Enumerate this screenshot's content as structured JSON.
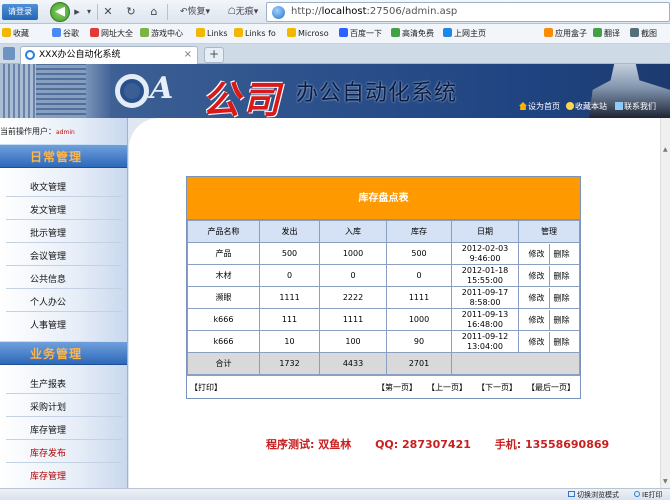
{
  "browser": {
    "login_label": "请登录",
    "back_glyph": "◀",
    "forward_glyph": "▸",
    "stop_glyph": "✕",
    "refresh_glyph": "↻",
    "home_glyph": "⌂",
    "restore_label": "恢复",
    "history_label": "无痕",
    "url_prefix": "http://",
    "url_host": "localhost",
    "url_rest": ":27506/admin.asp"
  },
  "bookmarks": [
    {
      "label": "收藏",
      "color": "#f2b800"
    },
    {
      "label": "谷歌",
      "color": "#4a8af4"
    },
    {
      "label": "网址大全",
      "color": "#e53935"
    },
    {
      "label": "游戏中心",
      "color": "#7cb342"
    },
    {
      "label": "Links",
      "color": "#f2b800"
    },
    {
      "label": "Links fo",
      "color": "#f2b800"
    },
    {
      "label": "Microso",
      "color": "#f2b800"
    },
    {
      "label": "百度一下",
      "color": "#2962ff"
    },
    {
      "label": "高清免费",
      "color": "#43a047"
    },
    {
      "label": "上网主页",
      "color": "#1e88e5"
    },
    {
      "label": "应用盒子",
      "color": "#fb8c00"
    },
    {
      "label": "翻译",
      "color": "#43a047"
    },
    {
      "label": "截图",
      "color": "#546e7a"
    }
  ],
  "tab": {
    "title": "XXX办公自动化系统",
    "close_glyph": "×",
    "new_tab_glyph": "+"
  },
  "banner": {
    "logo_text": "A",
    "company": "公司",
    "title": "办公自动化系统",
    "links": [
      "设为首页",
      "收藏本站",
      "联系我们"
    ]
  },
  "sidebar": {
    "current_user_label": "当前操作用户：",
    "current_user_value": "admin",
    "sections": [
      {
        "title": "日常管理",
        "items": [
          "收文管理",
          "发文管理",
          "批示管理",
          "会议管理",
          "公共信息",
          "个人办公",
          "人事管理"
        ]
      },
      {
        "title": "业务管理",
        "items": [
          "生产报表",
          "采购计划",
          "库存管理",
          "库存发布",
          "库存管理"
        ]
      }
    ]
  },
  "inventory": {
    "title": "库存盘点表",
    "headers": [
      "产品名称",
      "发出",
      "入库",
      "库存",
      "日期",
      "管理"
    ],
    "rows": [
      {
        "name": "产品",
        "out": "500",
        "in": "1000",
        "stock": "500",
        "date": "2012-02-03",
        "time": "9:46:00"
      },
      {
        "name": "木材",
        "out": "0",
        "in": "0",
        "stock": "0",
        "date": "2012-01-18",
        "time": "15:55:00"
      },
      {
        "name": "濒眼",
        "out": "1111",
        "in": "2222",
        "stock": "1111",
        "date": "2011-09-17",
        "time": "8:58:00"
      },
      {
        "name": "k666",
        "out": "111",
        "in": "1111",
        "stock": "1000",
        "date": "2011-09-13",
        "time": "16:48:00"
      },
      {
        "name": "k666",
        "out": "10",
        "in": "100",
        "stock": "90",
        "date": "2011-09-12",
        "time": "13:04:00"
      }
    ],
    "edit_label": "修改",
    "delete_label": "删除",
    "total": {
      "label": "合计",
      "out": "1732",
      "in": "4433",
      "stock": "2701"
    },
    "pager": {
      "print": "【打印】",
      "first": "【第一页】",
      "prev": "【上一页】",
      "next": "【下一页】",
      "last": "【最后一页】"
    }
  },
  "footer": {
    "tester": "程序测试: 双鱼林",
    "qq": "QQ: 287307421",
    "phone": "手机: 13558690869"
  },
  "statusbar": {
    "switch_mode": "切换浏览模式",
    "ie_label": "IE打印"
  }
}
